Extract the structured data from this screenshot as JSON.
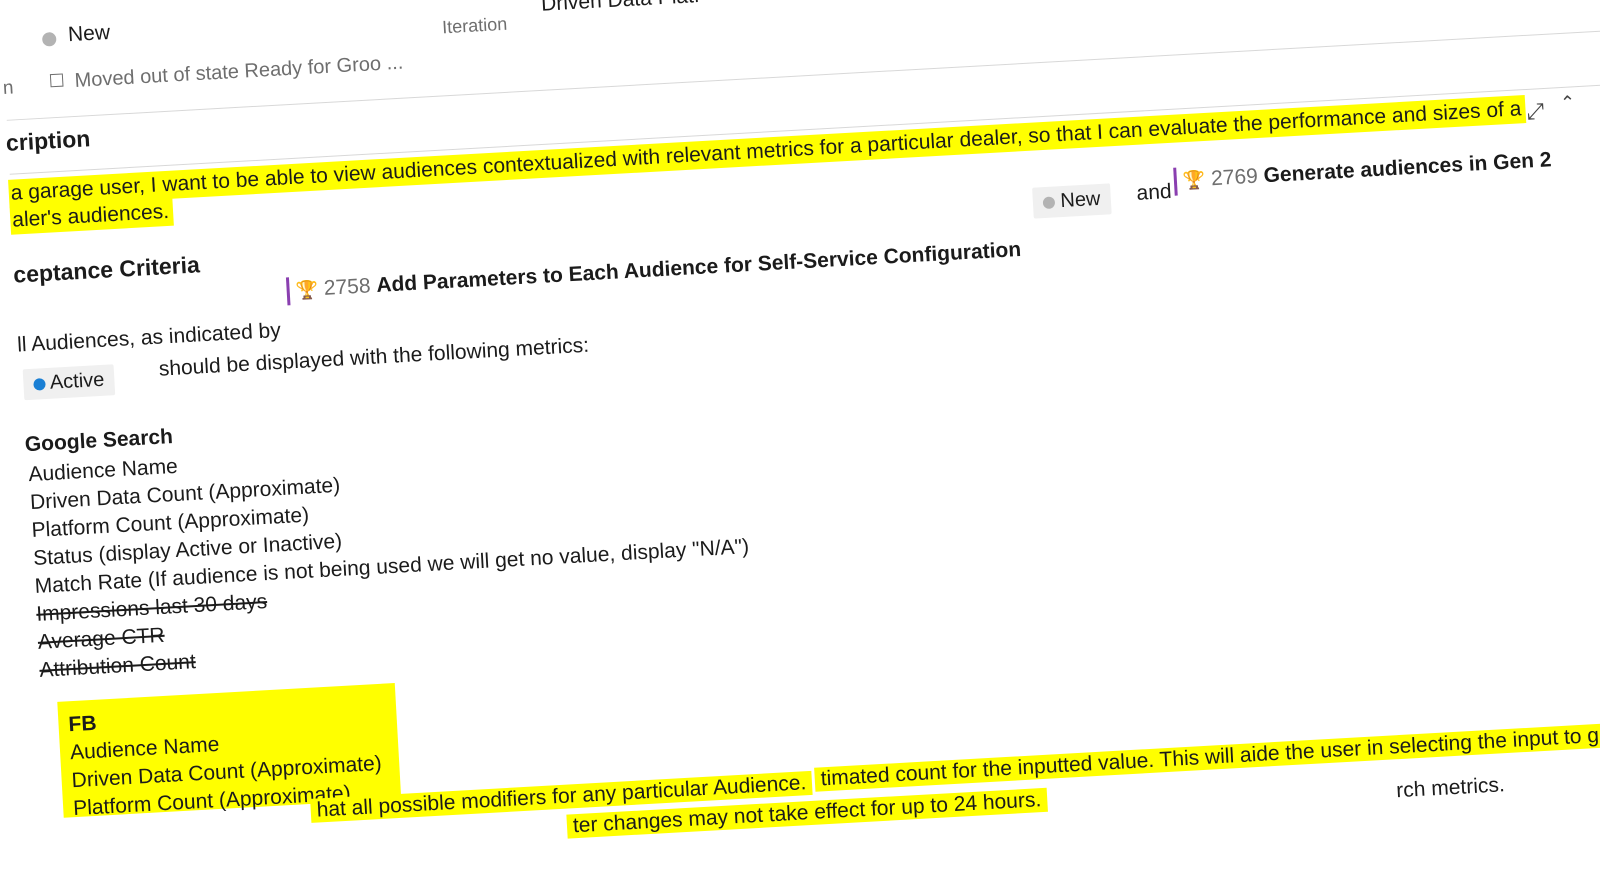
{
  "header": {
    "state_value": "New",
    "state_reason": "Moved out of state Ready for Groo ...",
    "iteration_label": "Iteration",
    "iteration_value": "Driven Data Platf",
    "cut_label_left": "n",
    "expand_icon": "expand-icon",
    "collapse_icon": "chevron-up-icon"
  },
  "description": {
    "title": "cription",
    "line1": "a garage user, I want to be able to view audiences contextualized with relevant metrics for a particular dealer, so that I can evaluate the performance and sizes of a",
    "line2": "aler's audiences."
  },
  "acceptance": {
    "title": "ceptance Criteria",
    "ref1": {
      "number": "2758",
      "title": "Add Parameters to Each Audience for Self-Service Configuration",
      "state": "New",
      "state_color": "#b3b3b3"
    },
    "and_text": "and",
    "ref2": {
      "number": "2769",
      "title": "Generate audiences in Gen 2"
    },
    "intro_prefix": "ll Audiences, as indicated by",
    "active_state": "Active",
    "active_color": "#1a7fd4",
    "intro_suffix": "should be displayed with the following metrics:",
    "google": {
      "heading": "Google Search",
      "items": [
        "Audience Name",
        "Driven Data Count (Approximate)",
        "Platform Count (Approximate)",
        "Status (display Active or Inactive)",
        "Match Rate (If audience is not being used we will get no value, display \"N/A\")"
      ],
      "struck_items": [
        "Impressions last 30 days",
        "Average CTR",
        "Attribution Count"
      ]
    },
    "fb": {
      "heading": "FB",
      "items": [
        "Audience Name",
        "Driven Data Count (Approximate)",
        "Platform Count (Approximate)"
      ]
    },
    "bottom_lines": [
      "hat all possible modifiers for any particular Audience.",
      "ter changes may not take effect for up to 24 hours.",
      "timated count for the inputted value. This will aide the user in selecting the input to gai",
      "rch metrics."
    ]
  }
}
